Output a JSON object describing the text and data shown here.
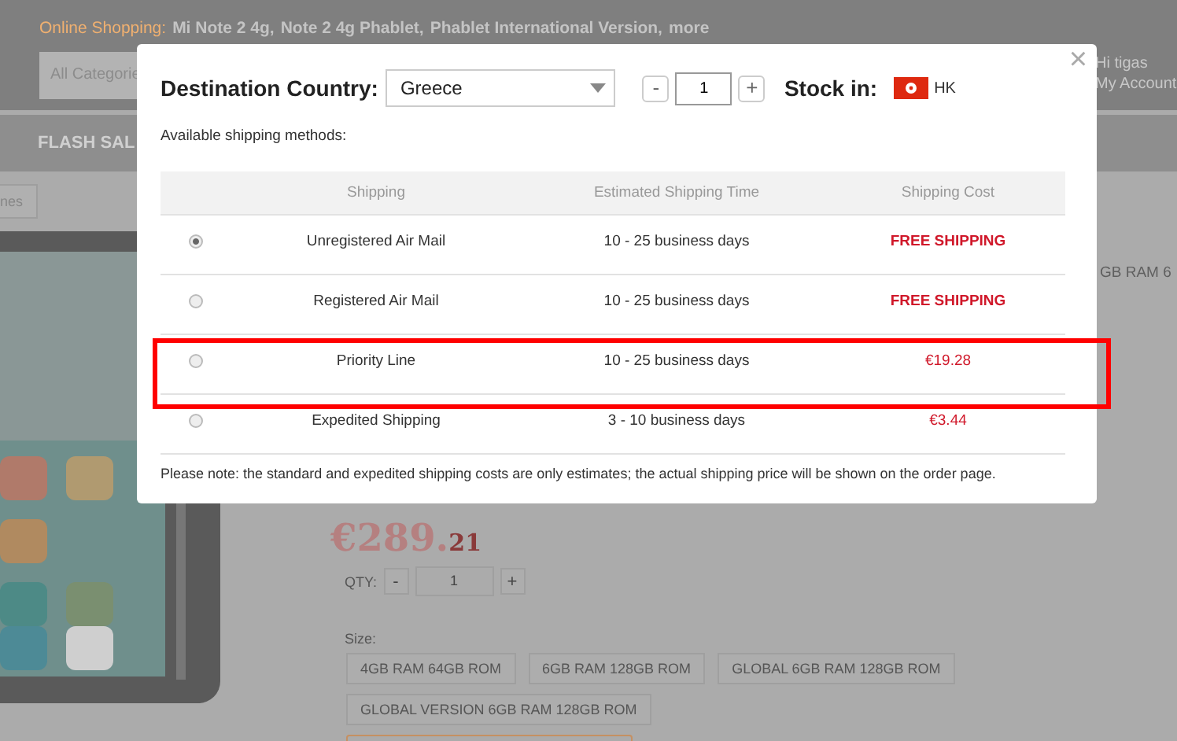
{
  "header": {
    "promo_label": "Online Shopping:",
    "promo_links": [
      "Mi Note 2 4g,",
      "Note 2 4g Phablet,",
      "Phablet International Version,",
      "more"
    ],
    "category_select": "All Categorie",
    "greeting": "Hi tigas",
    "account_link": "My Account"
  },
  "nav": {
    "items": [
      "FLASH SAL"
    ]
  },
  "breadcrumb": "nes",
  "product": {
    "title": "GB RAM 6",
    "price_main": "€289.",
    "price_cents": "21",
    "qty_label": "QTY:",
    "qty_minus": "-",
    "qty_value": "1",
    "qty_plus": "+",
    "size_label": "Size:",
    "sizes": [
      "4GB RAM 64GB ROM",
      "6GB RAM 128GB ROM",
      "GLOBAL 6GB RAM 128GB ROM",
      "GLOBAL VERSION 6GB RAM 128GB ROM"
    ]
  },
  "dialog": {
    "close": "×",
    "country_label": "Destination Country:",
    "country": "Greece",
    "qty_minus": "-",
    "qty_value": "1",
    "qty_plus": "+",
    "stock_label": "Stock in:",
    "stock_location": "HK",
    "methods_label": "Available shipping methods:",
    "columns": [
      "Shipping",
      "Estimated Shipping Time",
      "Shipping Cost"
    ],
    "rows": [
      {
        "selected": true,
        "highlighted": false,
        "method": "Unregistered Air Mail",
        "time": "10 - 25 business days",
        "cost": "FREE SHIPPING",
        "free": true
      },
      {
        "selected": false,
        "highlighted": false,
        "method": "Registered Air Mail",
        "time": "10 - 25 business days",
        "cost": "FREE SHIPPING",
        "free": true
      },
      {
        "selected": false,
        "highlighted": true,
        "method": "Priority Line",
        "time": "10 - 25 business days",
        "cost": "€19.28",
        "free": false
      },
      {
        "selected": false,
        "highlighted": false,
        "method": "Expedited Shipping",
        "time": "3 - 10 business days",
        "cost": "€3.44",
        "free": false
      }
    ],
    "note": "Please note: the standard and expedited shipping costs are only estimates; the actual shipping price will be shown on the order page."
  }
}
